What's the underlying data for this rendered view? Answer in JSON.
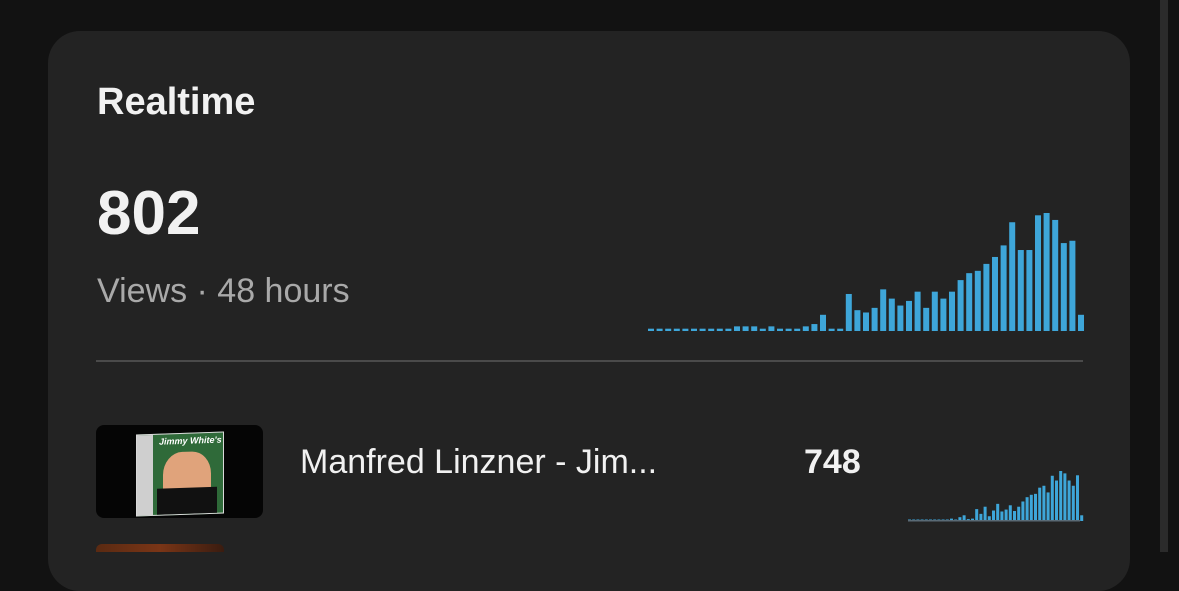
{
  "card": {
    "title": "Realtime",
    "views": "802",
    "subtitle": "Views · 48 hours"
  },
  "chart_data": [
    {
      "type": "bar",
      "series": [
        {
          "values": [
            0.5,
            0.5,
            0.5,
            0.5,
            0.5,
            0.5,
            0.5,
            0.5,
            0.5,
            0.5,
            1,
            1,
            1,
            0.5,
            1,
            0.5,
            0.5,
            0.5,
            1,
            1.5,
            3.5,
            0.5,
            0.5,
            8,
            4.5,
            4,
            5,
            9,
            7,
            5.5,
            6.5,
            8.5,
            5,
            8.5,
            7,
            8.5,
            11,
            12.5,
            13,
            14.5,
            16,
            18.5,
            23.5,
            17.5,
            17.5,
            25,
            25.5,
            24,
            19,
            19.5,
            3.5
          ]
        }
      ],
      "color": "#3ea6d9"
    },
    {
      "type": "bar",
      "series": [
        {
          "values": [
            0,
            0,
            0,
            0,
            0,
            0,
            0,
            0,
            0,
            0.3,
            0.5,
            0.3,
            0.8,
            1.2,
            0.4,
            0.5,
            2.5,
            1.5,
            3,
            1,
            2.2,
            3.6,
            2,
            2.4,
            3.3,
            2.1,
            3,
            4.1,
            5,
            5.5,
            5.7,
            7,
            7.4,
            6,
            9.5,
            8.5,
            10.5,
            10,
            8.5,
            7.4,
            9.6,
            1.2
          ]
        }
      ],
      "color": "#3ea6d9"
    }
  ],
  "rows": [
    {
      "title": "Manfred Linzner - Jim...",
      "count": "748",
      "thumbnail_text": "Jimmy White's"
    }
  ]
}
